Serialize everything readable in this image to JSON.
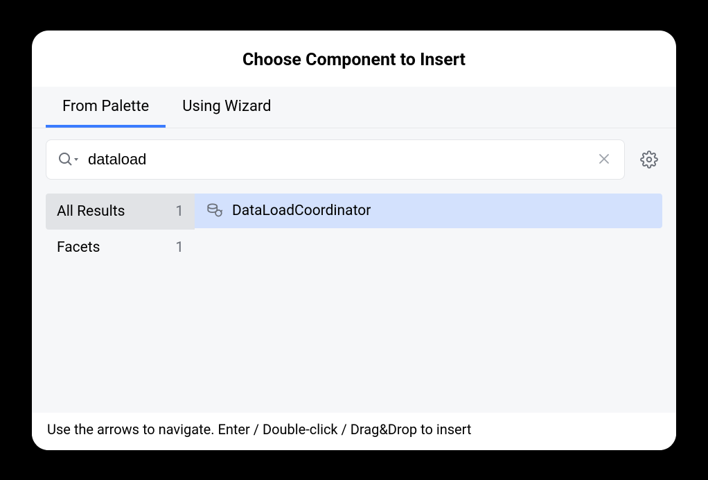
{
  "dialog": {
    "title": "Choose Component to Insert"
  },
  "tabs": [
    {
      "label": "From Palette",
      "active": true
    },
    {
      "label": "Using Wizard",
      "active": false
    }
  ],
  "search": {
    "value": "dataload",
    "placeholder": ""
  },
  "categories": [
    {
      "label": "All Results",
      "count": "1",
      "selected": true
    },
    {
      "label": "Facets",
      "count": "1",
      "selected": false
    }
  ],
  "results": [
    {
      "label": "DataLoadCoordinator",
      "selected": true
    }
  ],
  "footer": {
    "hint": "Use the arrows to navigate.  Enter / Double-click / Drag&Drop to insert"
  }
}
